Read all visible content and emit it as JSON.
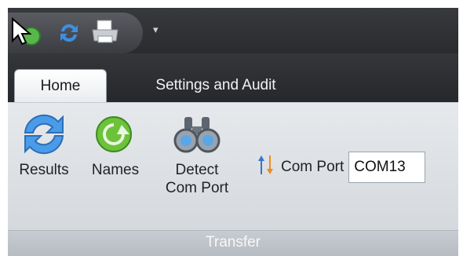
{
  "qat": {
    "icons": [
      "cursor-arrow-icon",
      "refresh-icon",
      "printer-icon",
      "customize-dropdown-icon"
    ],
    "more_glyph": "▾"
  },
  "tabs": [
    {
      "label": "Home",
      "active": true
    },
    {
      "label": "Settings and Audit",
      "active": false
    }
  ],
  "ribbon": {
    "buttons": [
      {
        "label": "Results",
        "icon": "refresh-icon"
      },
      {
        "label": "Names",
        "icon": "green-refresh-icon"
      },
      {
        "label_line1": "Detect",
        "label_line2": "Com Port",
        "icon": "binoculars-icon"
      }
    ],
    "com_port": {
      "label": "Com Port",
      "value": "COM13",
      "icon": "sort-arrows-icon"
    },
    "group_label": "Transfer"
  },
  "colors": {
    "titlebar": "#2c2e32",
    "ribbon": "#dfe3e7",
    "group_label_bg": "#bfc5cb"
  }
}
